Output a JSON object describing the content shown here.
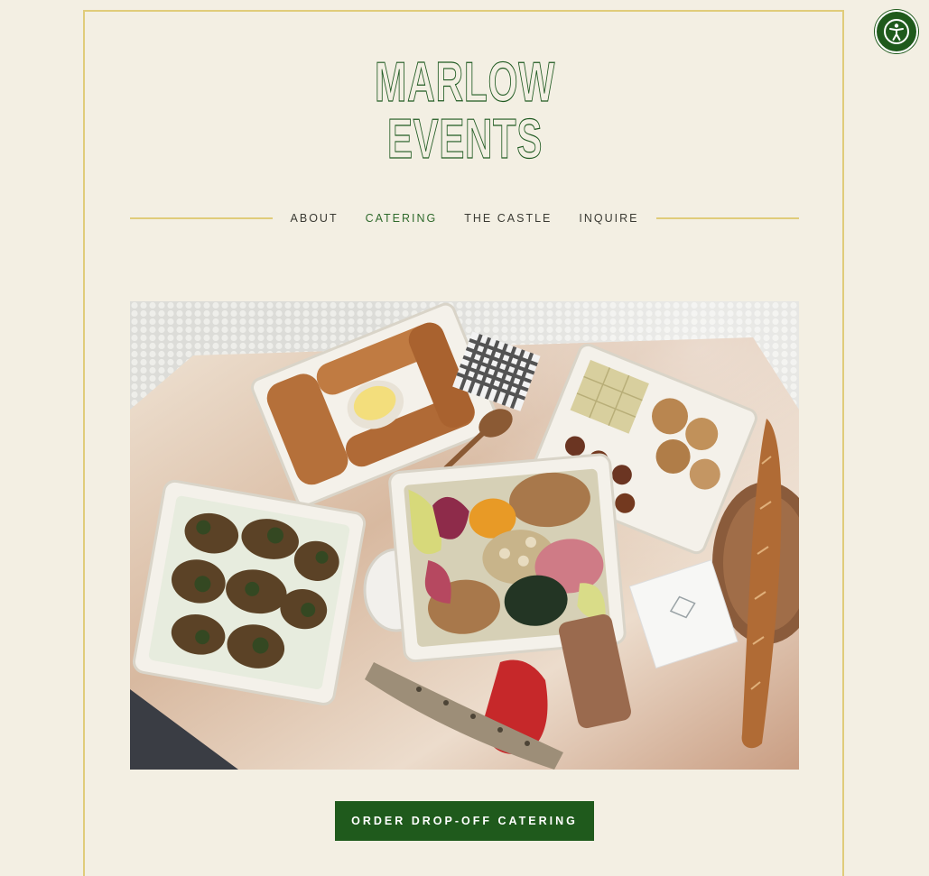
{
  "brand": {
    "line1": "MARLOW",
    "line2": "EVENTS",
    "color": "#1f5a21"
  },
  "nav": {
    "items": [
      {
        "label": "ABOUT",
        "active": false
      },
      {
        "label": "CATERING",
        "active": true
      },
      {
        "label": "THE CASTLE",
        "active": false
      },
      {
        "label": "INQUIRE",
        "active": false
      }
    ],
    "accent_line_color": "#e0cc7a"
  },
  "hero": {
    "icon": "catering-spread-photo"
  },
  "cta": {
    "label": "ORDER DROP-OFF CATERING",
    "color": "#1f5a1c"
  },
  "accessibility": {
    "icon": "accessibility-icon"
  },
  "colors": {
    "background": "#f3efe3",
    "frame": "#e0cc7a"
  }
}
